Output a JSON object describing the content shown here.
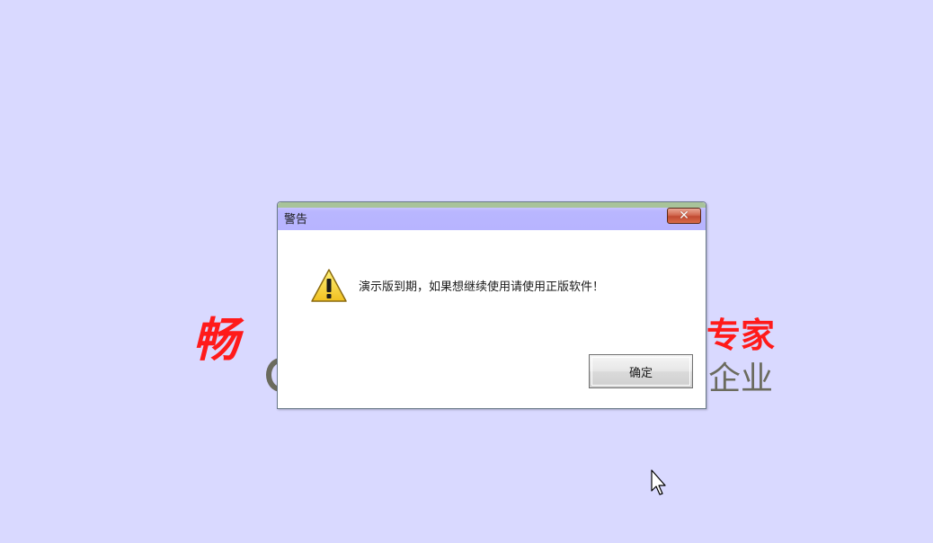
{
  "background": {
    "color": "#d9d9ff",
    "splash_left_red": "畅",
    "splash_right_red": "专家",
    "splash_right_gray": "企业"
  },
  "dialog": {
    "title": "警告",
    "close_glyph": "✕",
    "message": "演示版到期，如果想继续使用请使用正版软件！",
    "ok_label": "确定",
    "icon": "warning-triangle-icon"
  },
  "colors": {
    "accent_red": "#ff1a1a",
    "titlebar": "#b7b4ff",
    "close_button": "#c14a32"
  }
}
